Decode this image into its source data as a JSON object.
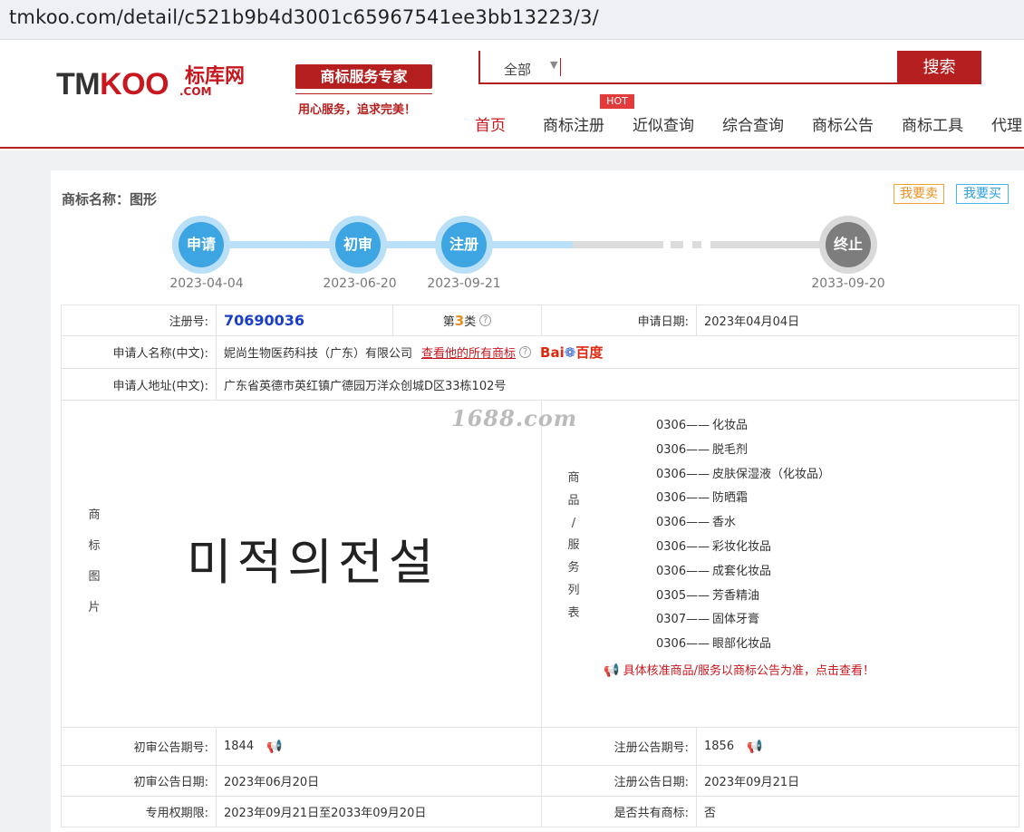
{
  "browser": {
    "url": "tmkoo.com/detail/c521b9b4d3001c65967541ee3bb13223/3/"
  },
  "header": {
    "logo_tm": "TM",
    "logo_koo": "KOO",
    "logo_cn": "标库网",
    "logo_com": ".COM",
    "slogan": "商标服务专家",
    "slogan_sub": "用心服务，追求完美！",
    "search_scope": "全部",
    "search_button": "搜索",
    "hot_badge": "HOT",
    "nav": [
      "首页",
      "商标注册",
      "近似查询",
      "综合查询",
      "商标公告",
      "商标工具",
      "代理"
    ]
  },
  "detail": {
    "name_label": "商标名称：图形",
    "sell_button": "我要卖",
    "buy_button": "我要买",
    "timeline": [
      {
        "label": "申请",
        "date": "2023-04-04"
      },
      {
        "label": "初审",
        "date": "2023-06-20"
      },
      {
        "label": "注册",
        "date": "2023-09-21"
      },
      {
        "label": "终止",
        "date": "2033-09-20"
      }
    ],
    "reg_no_label": "注册号:",
    "reg_no": "70690036",
    "class_prefix": "第",
    "class_num": "3",
    "class_suffix": "类",
    "apply_date_label": "申请日期:",
    "apply_date": "2023年04月04日",
    "applicant_label": "申请人名称(中文):",
    "applicant": "妮尚生物医药科技（广东）有限公司",
    "view_all_link": "查看他的所有商标",
    "baidu_bai": "Bai",
    "baidu_du": "百度",
    "address_label": "申请人地址(中文):",
    "address": "广东省英德市英红镇广德园万洋众创城D区33栋102号",
    "image_label": [
      "商",
      "标",
      "图",
      "片"
    ],
    "tm_image_text": "미적의전설",
    "watermark": "1688.com",
    "goods_label": [
      "商",
      "品",
      "/",
      "服",
      "务",
      "列",
      "表"
    ],
    "goods": [
      {
        "code": "0306——",
        "name": "化妆品"
      },
      {
        "code": "0306——",
        "name": "脱毛剂"
      },
      {
        "code": "0306——",
        "name": "皮肤保湿液（化妆品）"
      },
      {
        "code": "0306——",
        "name": "防晒霜"
      },
      {
        "code": "0306——",
        "name": "香水"
      },
      {
        "code": "0306——",
        "name": "彩妆化妆品"
      },
      {
        "code": "0306——",
        "name": "成套化妆品"
      },
      {
        "code": "0305——",
        "name": "芳香精油"
      },
      {
        "code": "0307——",
        "name": "固体牙膏"
      },
      {
        "code": "0306——",
        "name": "眼部化妆品"
      }
    ],
    "goods_notice": "具体核准商品/服务以商标公告为准，点击查看！",
    "prelim_no_label": "初审公告期号:",
    "prelim_no": "1844",
    "reg_pub_no_label": "注册公告期号:",
    "reg_pub_no": "1856",
    "prelim_date_label": "初审公告日期:",
    "prelim_date": "2023年06月20日",
    "reg_pub_date_label": "注册公告日期:",
    "reg_pub_date": "2023年09月21日",
    "validity_label": "专用权期限:",
    "validity": "2023年09月21日至2033年09月20日",
    "shared_label": "是否共有商标:",
    "shared": "否"
  }
}
